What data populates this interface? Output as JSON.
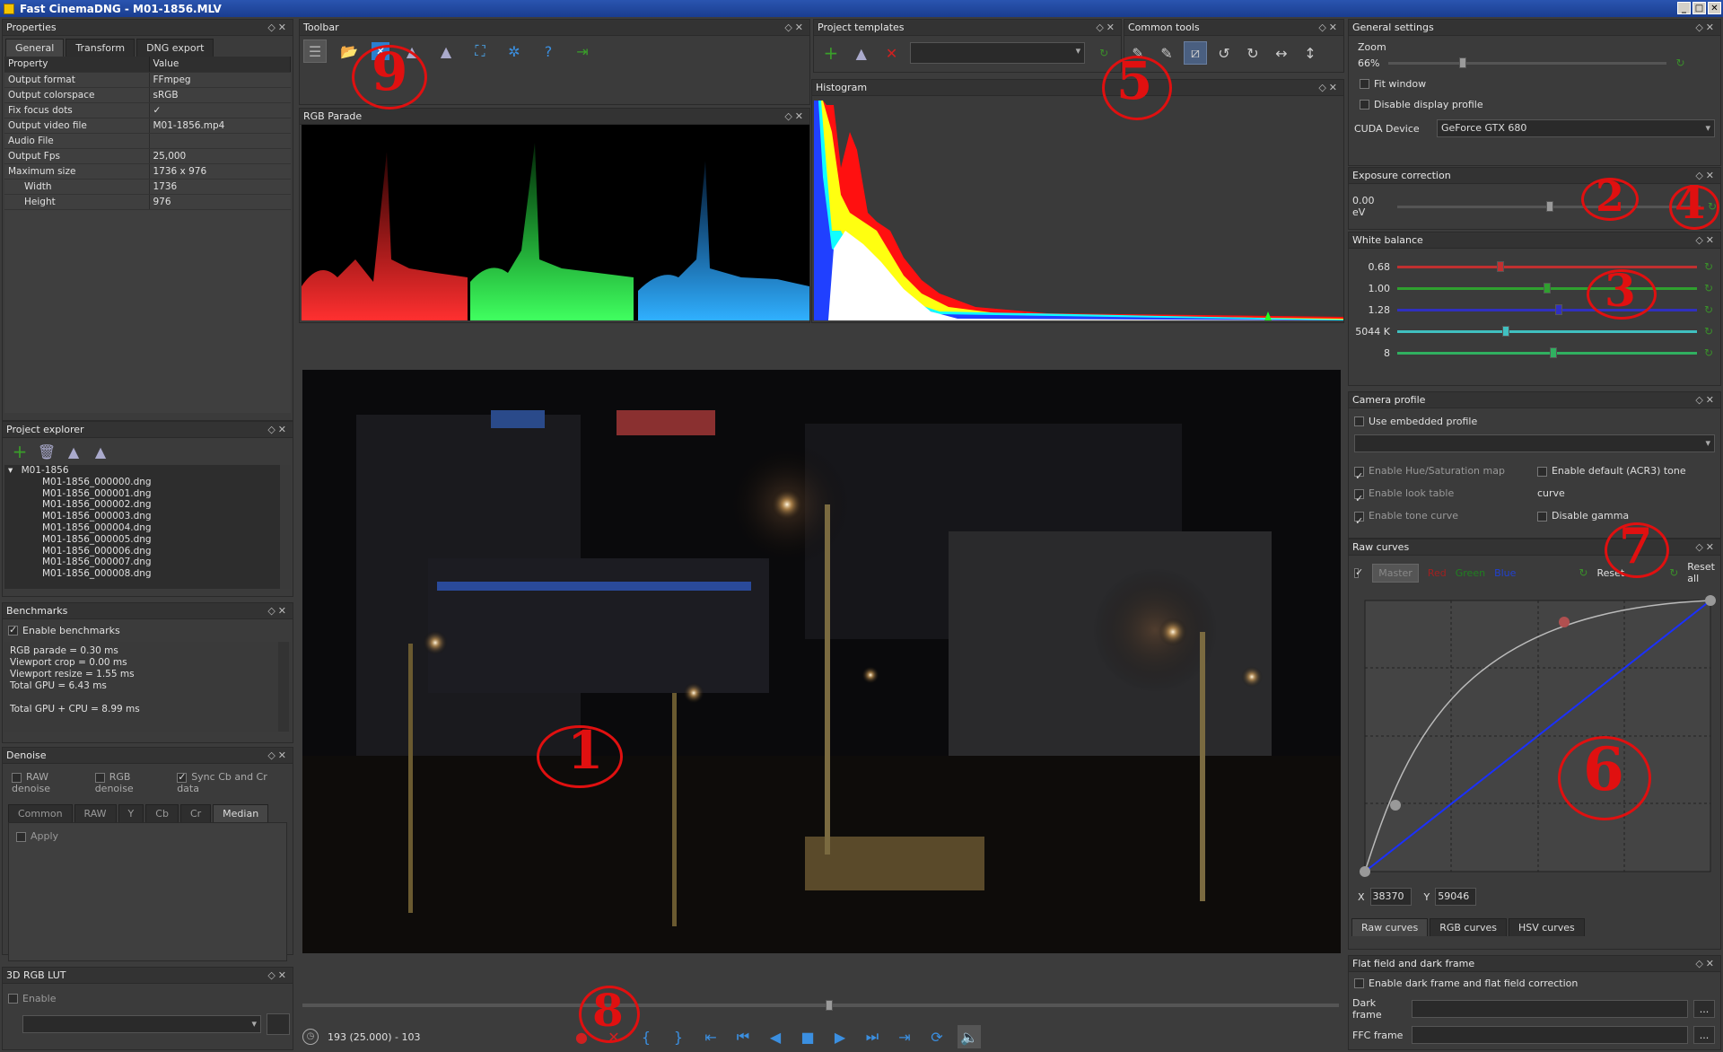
{
  "window": {
    "title": "Fast CinemaDNG - M01-1856.MLV"
  },
  "properties": {
    "title": "Properties",
    "tabs": [
      "General",
      "Transform",
      "DNG export"
    ],
    "col_property": "Property",
    "col_value": "Value",
    "rows": [
      {
        "name": "Output format",
        "value": "FFmpeg"
      },
      {
        "name": "Output colorspace",
        "value": "sRGB"
      },
      {
        "name": "Fix focus dots",
        "value": "✓"
      },
      {
        "name": "Output video file",
        "value": "M01-1856.mp4"
      },
      {
        "name": "Audio File",
        "value": ""
      },
      {
        "name": "Output Fps",
        "value": "25,000"
      },
      {
        "name": "Maximum size",
        "value": "1736 x 976"
      },
      {
        "name": "Width",
        "value": "1736"
      },
      {
        "name": "Height",
        "value": "976"
      }
    ]
  },
  "project_explorer": {
    "title": "Project explorer",
    "root": "M01-1856",
    "files": [
      "M01-1856_000000.dng",
      "M01-1856_000001.dng",
      "M01-1856_000002.dng",
      "M01-1856_000003.dng",
      "M01-1856_000004.dng",
      "M01-1856_000005.dng",
      "M01-1856_000006.dng",
      "M01-1856_000007.dng",
      "M01-1856_000008.dng"
    ]
  },
  "benchmarks": {
    "title": "Benchmarks",
    "enable_label": "Enable benchmarks",
    "lines": [
      "RGB parade = 0.30 ms",
      "Viewport crop = 0.00 ms",
      "Viewport resize = 1.55 ms",
      "Total GPU = 6.43 ms",
      "",
      "Total GPU + CPU = 8.99 ms"
    ]
  },
  "denoise": {
    "title": "Denoise",
    "raw_label": "RAW denoise",
    "rgb_label": "RGB denoise",
    "sync_label": "Sync Cb and Cr data",
    "tabs": [
      "Common",
      "RAW",
      "Y",
      "Cb",
      "Cr",
      "Median"
    ],
    "apply_label": "Apply"
  },
  "lut": {
    "title": "3D RGB LUT",
    "enable_label": "Enable"
  },
  "toolbar": {
    "title": "Toolbar"
  },
  "rgb_parade": {
    "title": "RGB Parade"
  },
  "project_templates": {
    "title": "Project templates"
  },
  "common_tools": {
    "title": "Common tools"
  },
  "histogram": {
    "title": "Histogram"
  },
  "general_settings": {
    "title": "General settings",
    "zoom_label": "Zoom",
    "zoom_value": "66%",
    "zoom_level": 0.66,
    "fit_window": "Fit window",
    "disable_profile": "Disable display profile",
    "cuda_label": "CUDA Device",
    "cuda_value": "GeForce GTX 680"
  },
  "exposure": {
    "title": "Exposure correction",
    "value": "0.00 eV"
  },
  "white_balance": {
    "title": "White balance",
    "rows": [
      {
        "label": "0.68",
        "level": 0.34,
        "color": "#c03030"
      },
      {
        "label": "1.00",
        "level": 0.5,
        "color": "#2fa02f"
      },
      {
        "label": "1.28",
        "level": 0.54,
        "color": "#3030c0"
      },
      {
        "label": "5044 K",
        "level": 0.36,
        "color": "#40c0c0"
      },
      {
        "label": "8",
        "level": 0.52,
        "color": "#30b060"
      }
    ]
  },
  "camera_profile": {
    "title": "Camera profile",
    "use_embedded": "Use embedded profile",
    "hue_sat": "Enable Hue/Saturation map",
    "look_table": "Enable look table",
    "tone_curve": "Enable tone curve",
    "default_curve": "Enable default (ACR3) tone curve",
    "disable_gamma": "Disable gamma"
  },
  "raw_curves": {
    "title": "Raw curves",
    "channels": [
      "Master",
      "Red",
      "Green",
      "Blue"
    ],
    "reset": "Reset",
    "reset_all": "Reset all",
    "x_label": "X",
    "x_value": "38370",
    "y_label": "Y",
    "y_value": "59046",
    "tabs": [
      "Raw curves",
      "RGB curves",
      "HSV curves"
    ]
  },
  "flat_field": {
    "title": "Flat field and dark frame",
    "enable_label": "Enable dark frame and flat field correction",
    "dark_label": "Dark frame",
    "ffc_label": "FFC frame",
    "browse": "..."
  },
  "playback": {
    "frame_info": "193 (25.000) - 103",
    "position": 0.505
  },
  "annotations": [
    "1",
    "2",
    "3",
    "4",
    "5",
    "6",
    "7",
    "8",
    "9"
  ],
  "colors": {
    "accent_green": "#3a9f2a",
    "annotation_red": "#e01010",
    "title_blue": "#1f4aa5"
  }
}
